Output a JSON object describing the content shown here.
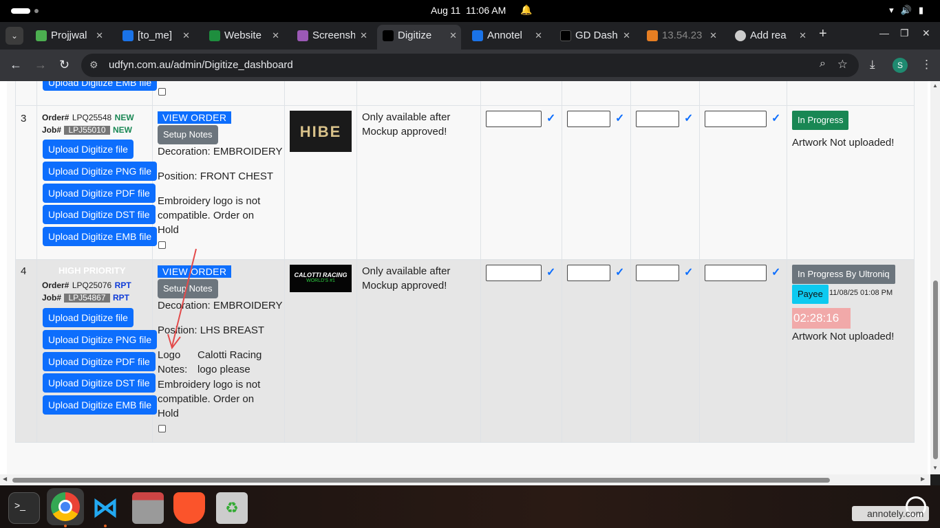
{
  "os": {
    "date": "Aug 11",
    "time": "11:06 AM"
  },
  "tabs": [
    {
      "label": "Projjwal",
      "favicon_color": "#4caf50"
    },
    {
      "label": "[to_me]",
      "favicon_color": "#1a73e8"
    },
    {
      "label": "Website",
      "favicon_color": "#1e8e3e"
    },
    {
      "label": "Screensh",
      "favicon_color": "#9b59b6"
    },
    {
      "label": "Digitize",
      "favicon_color": "#000000"
    },
    {
      "label": "Annotel",
      "favicon_color": "#1a73e8"
    },
    {
      "label": "GD Dash",
      "favicon_color": "#000000"
    },
    {
      "label": "13.54.23",
      "favicon_color": "#e67e22"
    },
    {
      "label": "Add rea",
      "favicon_color": "#cccccc"
    }
  ],
  "address": {
    "url": "udfyn.com.au/admin/Digitize_dashboard"
  },
  "profile_initial": "S",
  "top_partial": {
    "upload_emb_label": "Upload Digitize EMB file"
  },
  "rows": [
    {
      "num": "3",
      "priority": "",
      "order_label": "Order#",
      "order_no": "LPQ25548",
      "order_tag": "NEW",
      "job_label": "Job#",
      "job_no": "LPJ55010",
      "job_tag": "NEW",
      "uploads": [
        "Upload Digitize file",
        "Upload Digitize PNG file",
        "Upload Digitize PDF file",
        "Upload Digitize DST file",
        "Upload Digitize EMB file"
      ],
      "view_order": "VIEW ORDER",
      "setup_notes": "Setup Notes",
      "decoration": "Decoration: EMBROIDERY",
      "position": "Position: FRONT CHEST",
      "note": "Embroidery logo is not compatible. Order on Hold",
      "thumb_text": "HIBE",
      "mockup_note": "Only available after Mockup approved!",
      "status": "In Progress",
      "status_color": "#198754",
      "artwork": "Artwork Not uploaded!"
    },
    {
      "num": "4",
      "priority": "HIGH PRIORITY",
      "order_label": "Order#",
      "order_no": "LPQ25076",
      "order_tag": "RPT",
      "job_label": "Job#",
      "job_no": "LPJ54867",
      "job_tag": "RPT",
      "uploads": [
        "Upload Digitize file",
        "Upload Digitize PNG file",
        "Upload Digitize PDF file",
        "Upload Digitize DST file",
        "Upload Digitize EMB file"
      ],
      "view_order": "VIEW ORDER",
      "setup_notes": "Setup Notes",
      "decoration": "Decoration: EMBROIDERY",
      "position": "Position: LHS BREAST",
      "logo_notes_label_1": "Logo",
      "logo_notes_label_2": "Notes:",
      "logo_notes_val_1": "Calotti Racing",
      "logo_notes_val_2": "logo please",
      "note": "Embroidery logo is not compatible. Order on Hold",
      "thumb_text": "CALOTTI RACING",
      "thumb_sub": "WORLD'S #1",
      "mockup_note": "Only available after Mockup approved!",
      "status": "In Progress By Ultroniq",
      "status_color": "#6c757d",
      "payee": "Payee",
      "payee_color": "#0dcaf0",
      "payee_time": "11/08/25 01:08 PM",
      "timer": "02:28:16",
      "timer_bg": "#f1a9a9",
      "artwork": "Artwork Not uploaded!"
    }
  ],
  "watermark": "annotely.com"
}
